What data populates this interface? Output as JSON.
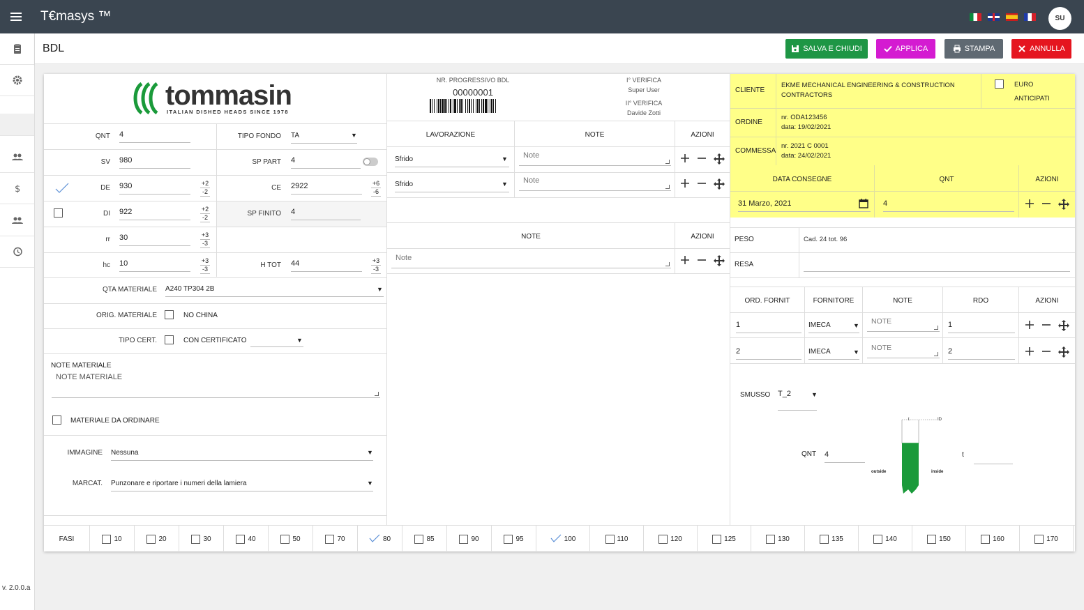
{
  "app": {
    "title": "T€masys ™",
    "avatar": "SU",
    "version": "v. 2.0.0.a"
  },
  "page": {
    "title": "BDL"
  },
  "buttons": {
    "save_close": "SALVA E CHIUDI",
    "apply": "APPLICA",
    "print": "STAMPA",
    "cancel": "ANNULLA"
  },
  "colors": {
    "save": "#1e9645",
    "apply": "#d41bd1",
    "print": "#5f6972",
    "cancel": "#e5151f",
    "highlight": "#ffff88",
    "accent": "#1a9a3a"
  },
  "logo": {
    "brand": "tommasin",
    "tagline": "ITALIAN DISHED HEADS SINCE 1978"
  },
  "form": {
    "qnt": {
      "label": "QNT",
      "value": "4"
    },
    "tipo_fondo": {
      "label": "TIPO FONDO",
      "value": "TA"
    },
    "sv": {
      "label": "SV",
      "value": "980"
    },
    "sp_part": {
      "label": "SP PART",
      "value": "4"
    },
    "de": {
      "label": "DE",
      "value": "930",
      "tol_plus": "+2",
      "tol_minus": "-2"
    },
    "ce": {
      "label": "CE",
      "value": "2922",
      "tol_plus": "+6",
      "tol_minus": "-6"
    },
    "di": {
      "label": "DI",
      "value": "922",
      "tol_plus": "+2",
      "tol_minus": "-2"
    },
    "sp_finito": {
      "label": "SP FINITO",
      "value": "4"
    },
    "rr": {
      "label": "rr",
      "value": "30",
      "tol_plus": "+3",
      "tol_minus": "-3"
    },
    "hc": {
      "label": "hc",
      "value": "10",
      "tol_plus": "+3",
      "tol_minus": "-3"
    },
    "h_tot": {
      "label": "H TOT",
      "value": "44",
      "tol_plus": "+3",
      "tol_minus": "-3"
    },
    "qta_materiale": {
      "label": "QTA MATERIALE",
      "value": "A240 TP304 2B"
    },
    "orig_materiale": {
      "label": "ORIG. MATERIALE",
      "option": "NO CHINA"
    },
    "tipo_cert": {
      "label": "TIPO CERT.",
      "option": "CON CERTIFICATO"
    },
    "note_materiale": {
      "label": "NOTE MATERIALE",
      "placeholder": "NOTE MATERIALE"
    },
    "materiale_da_ordinare": {
      "label": "MATERIALE DA ORDINARE"
    },
    "immagine": {
      "label": "IMMAGINE",
      "value": "Nessuna"
    },
    "marcat": {
      "label": "MARCAT.",
      "value": "Punzonare e riportare i numeri della lamiera"
    }
  },
  "bdl_header": {
    "progressivo_label": "NR. PROGRESSIVO BDL",
    "progressivo": "00000001",
    "verifica1_label": "I° VERIFICA",
    "verifica1_user": "Super User",
    "verifica2_label": "II° VERIFICA",
    "verifica2_user": "Davide Zotti"
  },
  "lavorazioni": {
    "headers": [
      "LAVORAZIONE",
      "NOTE",
      "AZIONI"
    ],
    "rows": [
      {
        "value": "Sfrido",
        "note_placeholder": "Note"
      },
      {
        "value": "Sfrido",
        "note_placeholder": "Note"
      }
    ]
  },
  "note_table": {
    "headers": [
      "NOTE",
      "AZIONI"
    ],
    "placeholder": "Note"
  },
  "cliente": {
    "label": "CLIENTE",
    "value": "EKME MECHANICAL ENGINEERING & CONSTRUCTION CONTRACTORS",
    "euro_label": "EURO",
    "anticipati_label": "ANTICIPATI"
  },
  "ordine": {
    "label": "ORDINE",
    "nr": "nr. ODA123456",
    "data": "data: 19/02/2021"
  },
  "commessa": {
    "label": "COMMESSA",
    "nr": "nr. 2021 C 0001",
    "data": "data: 24/02/2021"
  },
  "consegne": {
    "headers": [
      "DATA CONSEGNE",
      "QNT",
      "AZIONI"
    ],
    "date": "31 Marzo, 2021",
    "qnt": "4"
  },
  "peso": {
    "label": "PESO",
    "value": "Cad. 24 tot. 96"
  },
  "resa": {
    "label": "RESA",
    "value": ""
  },
  "fornitori": {
    "headers": [
      "ORD. FORNIT",
      "FORNITORE",
      "NOTE",
      "RDO",
      "AZIONI"
    ],
    "rows": [
      {
        "ord": "1",
        "fornitore": "IMECA",
        "note_placeholder": "NOTE",
        "rdo": "1"
      },
      {
        "ord": "2",
        "fornitore": "IMECA",
        "note_placeholder": "NOTE",
        "rdo": "2"
      }
    ]
  },
  "smusso": {
    "label": "SMUSSO",
    "value": "T_2",
    "qnt_label": "QNT",
    "qnt": "4",
    "t_label": "t",
    "t_value": "",
    "outside": "outside",
    "inside": "inside",
    "dim_t": "t",
    "dim_id": "ID"
  },
  "fasi": {
    "label": "FASI",
    "items": [
      {
        "n": "10",
        "checked": false
      },
      {
        "n": "20",
        "checked": false
      },
      {
        "n": "30",
        "checked": false
      },
      {
        "n": "40",
        "checked": false
      },
      {
        "n": "50",
        "checked": false
      },
      {
        "n": "70",
        "checked": false
      },
      {
        "n": "80",
        "checked": true
      },
      {
        "n": "85",
        "checked": false
      },
      {
        "n": "90",
        "checked": false
      },
      {
        "n": "95",
        "checked": false
      },
      {
        "n": "100",
        "checked": true
      },
      {
        "n": "110",
        "checked": false
      },
      {
        "n": "120",
        "checked": false
      },
      {
        "n": "125",
        "checked": false
      },
      {
        "n": "130",
        "checked": false
      },
      {
        "n": "135",
        "checked": false
      },
      {
        "n": "140",
        "checked": false
      },
      {
        "n": "150",
        "checked": false
      },
      {
        "n": "160",
        "checked": false
      },
      {
        "n": "170",
        "checked": false
      }
    ]
  }
}
